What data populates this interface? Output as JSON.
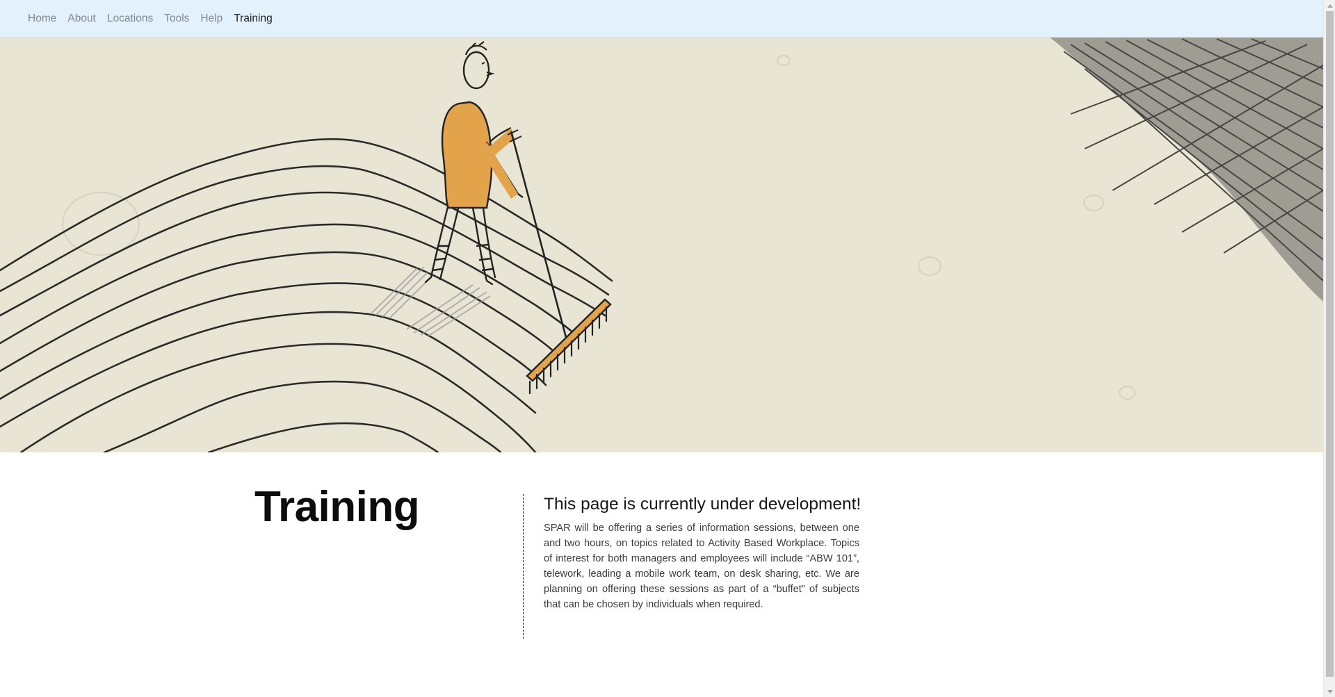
{
  "nav": {
    "items": [
      {
        "label": "Home"
      },
      {
        "label": "About"
      },
      {
        "label": "Locations"
      },
      {
        "label": "Tools"
      },
      {
        "label": "Help"
      },
      {
        "label": "Training"
      }
    ],
    "active": "Training"
  },
  "hero": {
    "image": "illustration of a person raking striped lines on a hill",
    "colors": {
      "background": "#e8e5d4",
      "accent": "#e3a34b",
      "ink": "#232323"
    }
  },
  "main": {
    "title": "Training",
    "subheading": "This page is currently under development!",
    "body": "SPAR will be offering a series of information sessions, between one and two hours, on topics related to Activity Based Workplace. Topics of interest for both managers and employees will include “ABW 101”, telework, leading a mobile work team, on desk sharing, etc. We are planning on offering these sessions as part of a “buffet” of subjects that can be chosen by individuals when required."
  },
  "colors": {
    "navbar_bg": "#e3f1fd",
    "nav_text": "#808890",
    "nav_active": "#1d1f21"
  }
}
